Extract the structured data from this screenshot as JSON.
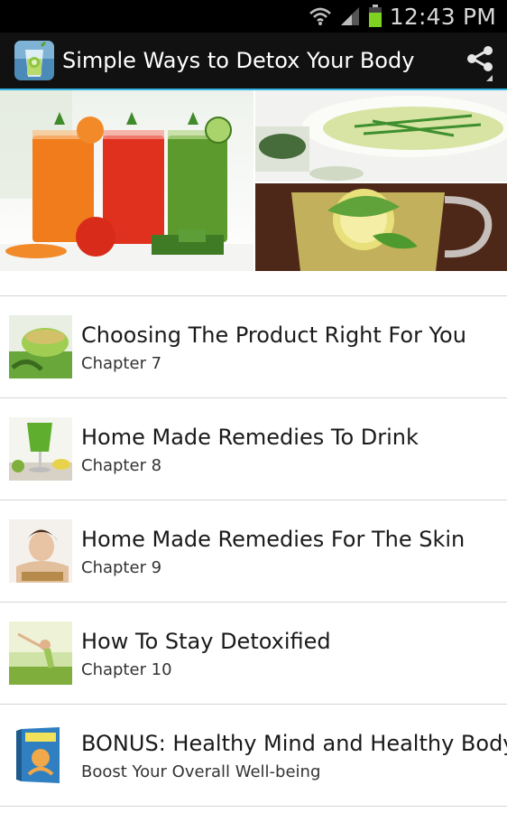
{
  "status_bar": {
    "time": "12:43 PM",
    "icons": [
      "wifi-icon",
      "signal-icon",
      "battery-icon"
    ]
  },
  "action_bar": {
    "title": "Simple Ways to Detox Your Body",
    "app_icon": "detox-drink-icon",
    "share_icon": "share-icon"
  },
  "banner": {
    "images": [
      "juice-glasses-image",
      "cucumber-soup-image",
      "lemon-mint-tea-image"
    ]
  },
  "chapters": [
    {
      "title": "Choosing The Product Right For You",
      "subtitle": "Chapter 7",
      "thumb": "green-tea-thumbnail"
    },
    {
      "title": "Home Made Remedies To Drink",
      "subtitle": "Chapter 8",
      "thumb": "green-smoothie-thumbnail"
    },
    {
      "title": "Home Made Remedies For The Skin",
      "subtitle": "Chapter 9",
      "thumb": "face-wash-thumbnail"
    },
    {
      "title": "How To Stay Detoxified",
      "subtitle": "Chapter 10",
      "thumb": "woman-stretching-thumbnail"
    },
    {
      "title": "BONUS: Healthy Mind and Healthy Body",
      "subtitle": "Boost Your Overall Well-being",
      "thumb": "ebook-cover-thumbnail"
    }
  ],
  "colors": {
    "action_bar_bg": "#111111",
    "accent_line": "#33b5e5",
    "status_bar_bg": "#000000"
  }
}
